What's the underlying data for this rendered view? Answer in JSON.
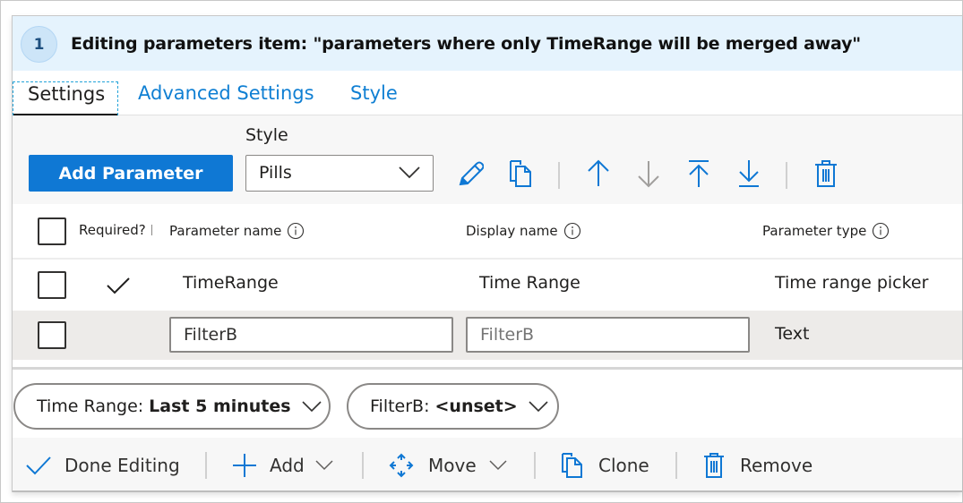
{
  "header": {
    "step_number": "1",
    "title": "Editing parameters item: \"parameters where only TimeRange will be merged away\""
  },
  "tabs": [
    {
      "label": "Settings",
      "active": true
    },
    {
      "label": "Advanced Settings",
      "active": false
    },
    {
      "label": "Style",
      "active": false
    }
  ],
  "toolbar": {
    "add_parameter_label": "Add Parameter",
    "style_label": "Style",
    "style_value": "Pills",
    "icons": [
      "edit-icon",
      "copy-icon",
      "move-up-icon",
      "move-down-icon",
      "move-to-top-icon",
      "move-to-bottom-icon",
      "delete-icon"
    ],
    "accent_color": "#0f78d4",
    "disabled_color": "#a19f9d"
  },
  "grid": {
    "columns": [
      {
        "label": "Required?"
      },
      {
        "label": "Parameter name"
      },
      {
        "label": "Display name"
      },
      {
        "label": "Parameter type"
      }
    ],
    "rows": [
      {
        "required": true,
        "parameter_name": "TimeRange",
        "display_name": "Time Range",
        "display_name_placeholder": "",
        "parameter_type": "Time range picker",
        "editing": false
      },
      {
        "required": false,
        "parameter_name": "FilterB",
        "display_name": "",
        "display_name_placeholder": "FilterB",
        "parameter_type": "Text",
        "editing": true
      }
    ]
  },
  "pills": [
    {
      "label": "Time Range:",
      "value": "Last 5 minutes"
    },
    {
      "label": "FilterB:",
      "value": "<unset>"
    }
  ],
  "footer": {
    "done_editing": "Done Editing",
    "add": "Add",
    "move": "Move",
    "clone": "Clone",
    "remove": "Remove"
  }
}
